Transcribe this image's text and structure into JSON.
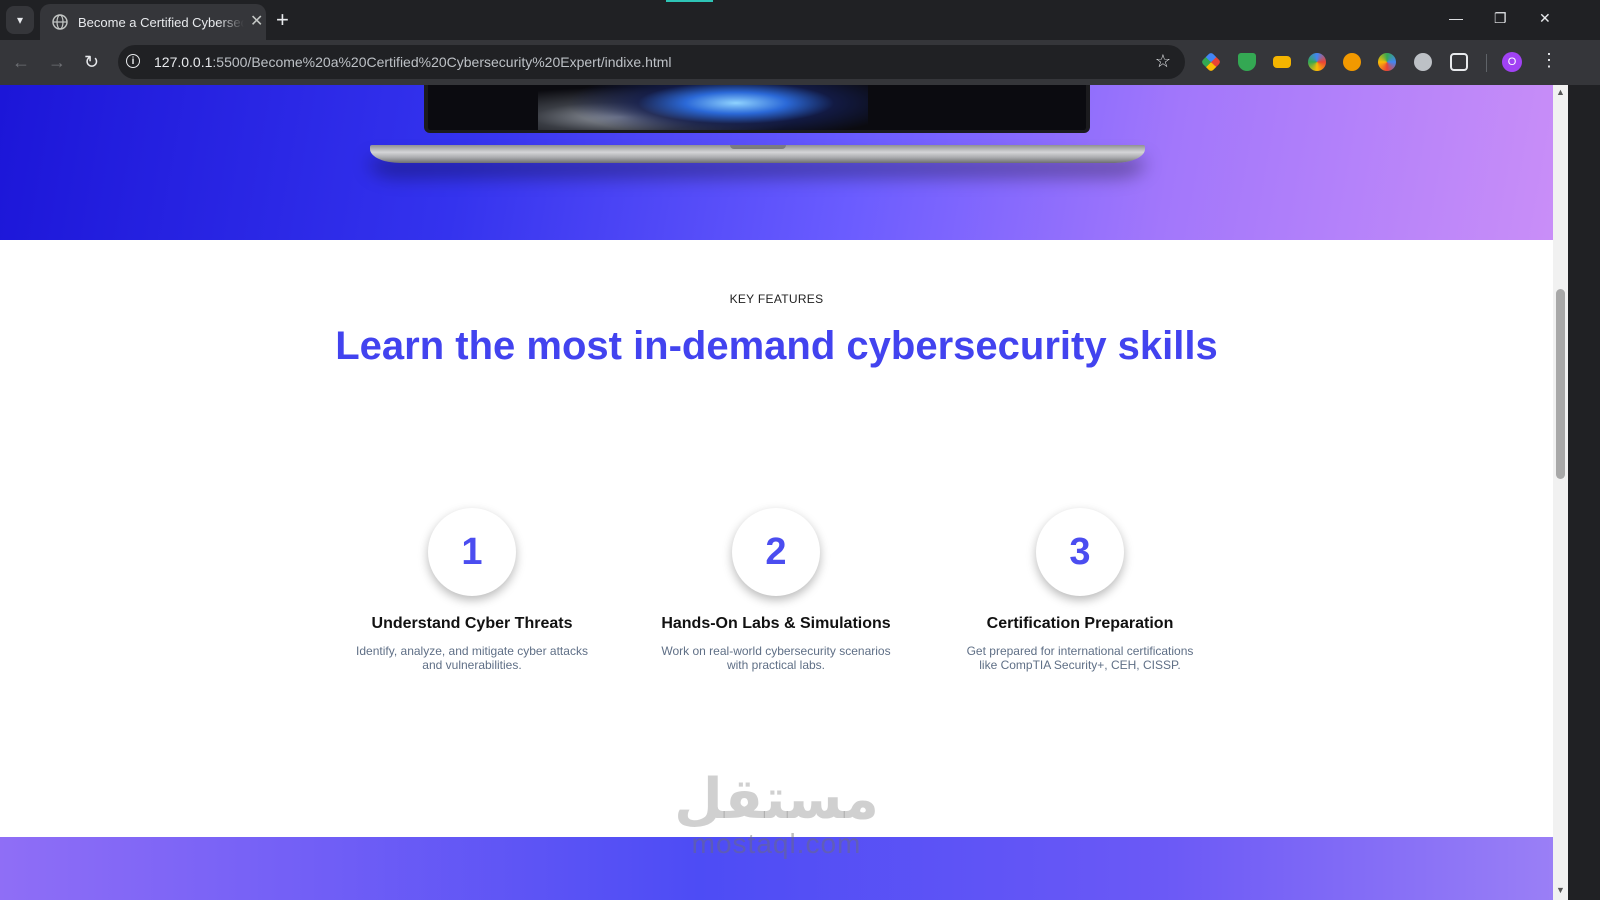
{
  "browser": {
    "tab_title": "Become a Certified Cybersecurity Expert",
    "tab_close": "✕",
    "new_tab": "+",
    "url_host": "127.0.0.1",
    "url_rest": ":5500/Become%20a%20Certified%20Cybersecurity%20Expert/indixe.html",
    "profile_initial": "O",
    "window_minimize": "—",
    "window_restore": "❐",
    "window_close": "✕"
  },
  "features": {
    "eyebrow": "KEY FEATURES",
    "headline": "Learn the most in-demand cybersecurity skills",
    "items": [
      {
        "number": "1",
        "title": "Understand Cyber Threats",
        "description": "Identify, analyze, and mitigate cyber attacks and vulnerabilities."
      },
      {
        "number": "2",
        "title": "Hands-On Labs & Simulations",
        "description": "Work on real-world cybersecurity scenarios with practical labs."
      },
      {
        "number": "3",
        "title": "Certification Preparation",
        "description": "Get prepared for international certifications like CompTIA Security+, CEH, CISSP."
      }
    ]
  },
  "watermark": {
    "arabic": "مستقل",
    "latin": "mostaql.com"
  },
  "colors": {
    "accent": "#4243ef",
    "number": "#4b4df0",
    "description": "#5f6f86"
  }
}
